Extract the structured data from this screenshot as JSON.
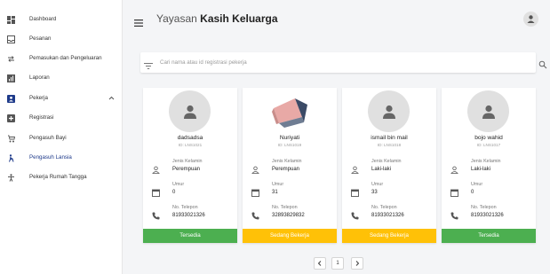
{
  "sidebar": {
    "items": [
      {
        "label": "Dashboard",
        "icon": "dashboard-icon"
      },
      {
        "label": "Pesanan",
        "icon": "inbox-icon"
      },
      {
        "label": "Pemasukan dan Pengeluaran",
        "icon": "swap-icon"
      },
      {
        "label": "Laporan",
        "icon": "chart-icon"
      },
      {
        "label": "Pekerja",
        "icon": "badge-icon"
      },
      {
        "label": "Registrasi",
        "icon": "plus-box-icon"
      },
      {
        "label": "Pengasuh Bayi",
        "icon": "stroller-icon"
      },
      {
        "label": "Pengasuh Lansia",
        "icon": "elderly-icon"
      },
      {
        "label": "Pekerja Rumah Tangga",
        "icon": "cleaning-icon"
      }
    ]
  },
  "header": {
    "title_prefix": "Yayasan",
    "title_name": "Kasih Keluarga"
  },
  "search": {
    "placeholder": "Cari nama atau id registrasi pekerja",
    "value": ""
  },
  "labels": {
    "gender": "Jenis Kelamin",
    "age": "Umur",
    "phone": "No. Telepon"
  },
  "workers": [
    {
      "name": "dadsadsa",
      "id": "ID: LNS1021",
      "gender": "Perempuan",
      "age": "0",
      "phone": "81933021326",
      "status": "Tersedia",
      "status_color": "#4caf50",
      "photo": false
    },
    {
      "name": "Nuriyati",
      "id": "ID: LNS1019",
      "gender": "Perempuan",
      "age": "31",
      "phone": "32893829832",
      "status": "Sedang Bekerja",
      "status_color": "#ffc107",
      "photo": true
    },
    {
      "name": "ismail bin mail",
      "id": "ID: LNS1018",
      "gender": "Laki-laki",
      "age": "33",
      "phone": "81933021326",
      "status": "Sedang Bekerja",
      "status_color": "#ffc107",
      "photo": false
    },
    {
      "name": "bojo wahid",
      "id": "ID: LNS1017",
      "gender": "Laki-laki",
      "age": "0",
      "phone": "81933021326",
      "status": "Tersedia",
      "status_color": "#4caf50",
      "photo": false
    }
  ],
  "pagination": {
    "current": "1"
  }
}
